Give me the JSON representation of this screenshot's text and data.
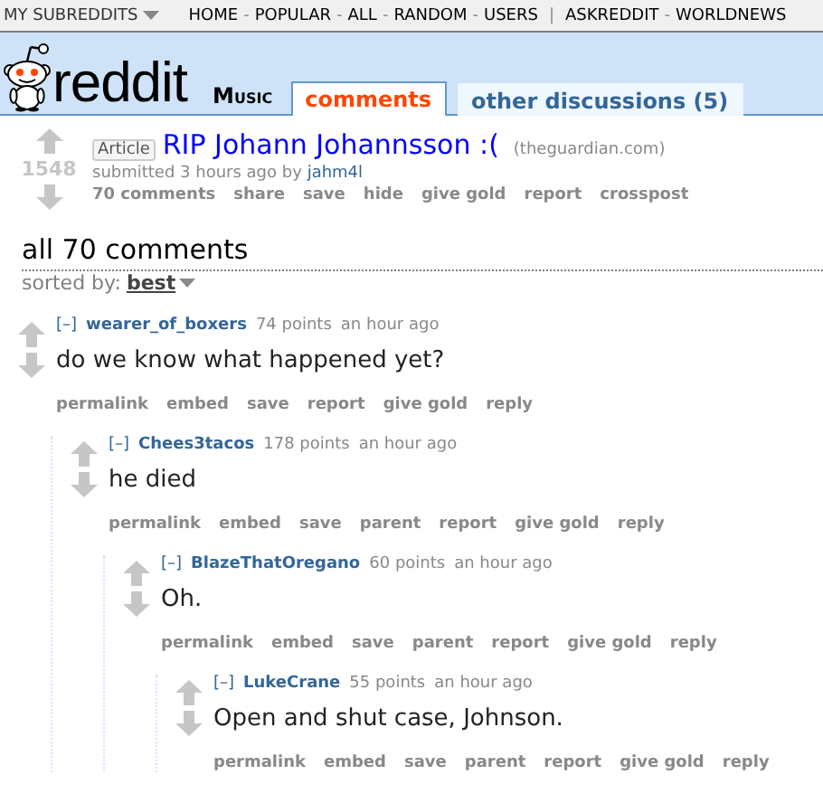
{
  "top_bar": {
    "my_subreddits": "MY SUBREDDITS",
    "nav_groups": [
      [
        "HOME",
        "POPULAR",
        "ALL",
        "RANDOM",
        "USERS"
      ],
      [
        "ASKREDDIT",
        "WORLDNEWS"
      ]
    ],
    "separator": "-",
    "group_separator": "|"
  },
  "header": {
    "logo_text": "reddit",
    "subreddit": "Music",
    "tabs": [
      {
        "label": "comments",
        "selected": true
      },
      {
        "label": "other discussions (5)",
        "selected": false
      }
    ]
  },
  "post": {
    "score": "1548",
    "flair": "Article",
    "title": "RIP Johann Johannsson :(",
    "domain": "(theguardian.com)",
    "tagline_prefix": "submitted 3 hours ago by",
    "author": "jahm4l",
    "buttons": [
      "70 comments",
      "share",
      "save",
      "hide",
      "give gold",
      "report",
      "crosspost"
    ]
  },
  "comments_heading": "all 70 comments",
  "sort": {
    "label": "sorted by:",
    "value": "best"
  },
  "comments": [
    {
      "collapse": "[–]",
      "author": "wearer_of_boxers",
      "score": "74 points",
      "time": "an hour ago",
      "body": "do we know what happened yet?",
      "actions": [
        "permalink",
        "embed",
        "save",
        "report",
        "give gold",
        "reply"
      ],
      "children": [
        {
          "collapse": "[–]",
          "author": "Chees3tacos",
          "score": "178 points",
          "time": "an hour ago",
          "body": "he died",
          "actions": [
            "permalink",
            "embed",
            "save",
            "parent",
            "report",
            "give gold",
            "reply"
          ],
          "children": [
            {
              "collapse": "[–]",
              "author": "BlazeThatOregano",
              "score": "60 points",
              "time": "an hour ago",
              "body": "Oh.",
              "actions": [
                "permalink",
                "embed",
                "save",
                "parent",
                "report",
                "give gold",
                "reply"
              ],
              "children": [
                {
                  "collapse": "[–]",
                  "author": "LukeCrane",
                  "score": "55 points",
                  "time": "an hour ago",
                  "body": "Open and shut case, Johnson.",
                  "actions": [
                    "permalink",
                    "embed",
                    "save",
                    "parent",
                    "report",
                    "give gold",
                    "reply"
                  ]
                }
              ]
            }
          ]
        }
      ]
    }
  ]
}
